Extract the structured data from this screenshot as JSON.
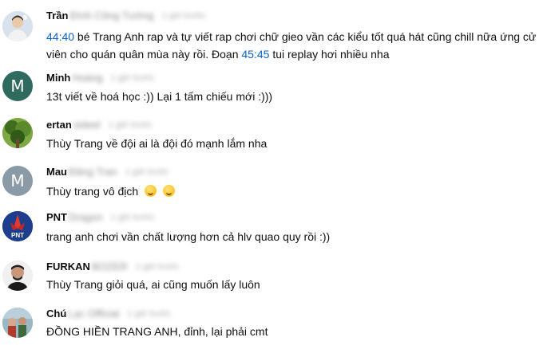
{
  "comments": [
    {
      "author": "Trần",
      "blurred_name": "Đình Công Tường",
      "blurred_time": "1 giờ trước",
      "text_parts": [
        {
          "type": "ts",
          "value": "44:40"
        },
        {
          "type": "text",
          "value": " bé Trang Anh rap và tự viết rap chơi chữ gieo vần các kiểu tốt quá hát cũng chill nữa ứng cử viên cho quán quân mùa này rồi. Đoạn "
        },
        {
          "type": "ts",
          "value": "45:45"
        },
        {
          "type": "text",
          "value": " tui replay hơi nhiều nha"
        }
      ],
      "avatar": {
        "kind": "photo",
        "icon": "user-photo-icon"
      }
    },
    {
      "author": "Minh",
      "blurred_name": "Hoàng",
      "blurred_time": "1 giờ trước",
      "text": "13t viết về hoá học :)) Lại 1 tấm chiếu mới :)))",
      "avatar": {
        "kind": "letter",
        "letter": "M",
        "color": "#2e6b5e"
      }
    },
    {
      "author": "ertan",
      "blurred_name": "sideel",
      "blurred_time": "1 giờ trước",
      "text": "Thùy Trang về đội ai là đội đó mạnh lắm nha",
      "avatar": {
        "kind": "photo",
        "icon": "tree-photo-icon"
      }
    },
    {
      "author": "Mau",
      "blurred_name": "Đăng Tran",
      "blurred_time": "1 giờ trước",
      "text": "Thùy trang vô địch",
      "emoji_count": 2,
      "emoji_icon": "hugging-face-icon",
      "avatar": {
        "kind": "letter",
        "letter": "M",
        "color": "#8a9aa6"
      }
    },
    {
      "author": "PNT",
      "blurred_name": "Dragon",
      "blurred_time": "1 giờ trước",
      "text": "trang anh chơi vần chất lượng hơn cả hlv quao quy rồi :))",
      "avatar": {
        "kind": "logo",
        "label": "PNT",
        "color": "#1d3e8c"
      }
    },
    {
      "author": "FURKAN",
      "blurred_name": "BOZER",
      "blurred_time": "1 giờ trước",
      "text": "Thùy Trang giỏi quá, ai cũng muốn lấy luôn",
      "avatar": {
        "kind": "photo",
        "icon": "man-photo-icon"
      }
    },
    {
      "author": "Chú",
      "blurred_name": "Lạc Official",
      "blurred_time": "1 giờ trước",
      "text": "ĐỒNG HIỀN TRANG ANH, đỉnh, lại phải cmt",
      "avatar": {
        "kind": "photo",
        "icon": "group-photo-icon"
      }
    }
  ]
}
